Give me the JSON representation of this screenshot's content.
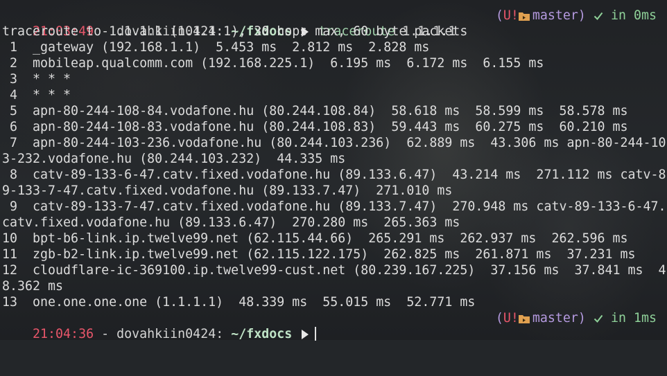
{
  "prompt1": {
    "time": "21:03:49",
    "sep": " - ",
    "user": "dovahkiin0424:",
    "path": "~/fxdocs",
    "command": "traceroute",
    "argument": "1.1.1.1",
    "git_open": "(",
    "git_status": "U!",
    "branch": "master",
    "git_close": ")",
    "duration": "in 0ms"
  },
  "output_lines": [
    "traceroute to 1.1.1.1 (1.1.1.1), 30 hops max, 60 byte packets",
    " 1  _gateway (192.168.1.1)  5.453 ms  2.812 ms  2.828 ms",
    " 2  mobileap.qualcomm.com (192.168.225.1)  6.195 ms  6.172 ms  6.155 ms",
    " 3  * * *",
    " 4  * * *",
    " 5  apn-80-244-108-84.vodafone.hu (80.244.108.84)  58.618 ms  58.599 ms  58.578 ms",
    " 6  apn-80-244-108-83.vodafone.hu (80.244.108.83)  59.443 ms  60.275 ms  60.210 ms",
    " 7  apn-80-244-103-236.vodafone.hu (80.244.103.236)  62.889 ms  43.306 ms apn-80-244-10",
    "3-232.vodafone.hu (80.244.103.232)  44.335 ms",
    " 8  catv-89-133-6-47.catv.fixed.vodafone.hu (89.133.6.47)  43.214 ms  271.112 ms catv-8",
    "9-133-7-47.catv.fixed.vodafone.hu (89.133.7.47)  271.010 ms",
    " 9  catv-89-133-7-47.catv.fixed.vodafone.hu (89.133.7.47)  270.948 ms catv-89-133-6-47.",
    "catv.fixed.vodafone.hu (89.133.6.47)  270.280 ms  265.363 ms",
    "10  bpt-b6-link.ip.twelve99.net (62.115.44.66)  265.291 ms  262.937 ms  262.596 ms",
    "11  zgb-b2-link.ip.twelve99.net (62.115.122.175)  262.825 ms  261.871 ms  37.231 ms",
    "12  cloudflare-ic-369100.ip.twelve99-cust.net (80.239.167.225)  37.156 ms  37.841 ms  4",
    "8.362 ms",
    "13  one.one.one.one (1.1.1.1)  48.339 ms  55.015 ms  52.771 ms"
  ],
  "prompt2": {
    "time": "21:04:36",
    "sep": " - ",
    "user": "dovahkiin0424:",
    "path": "~/fxdocs",
    "git_open": "(",
    "git_status": "U!",
    "branch": "master",
    "git_close": ")",
    "duration": "in 1ms"
  },
  "colors": {
    "background": "#232629",
    "time": "#e8566a",
    "path": "#bfe3c6",
    "command": "#9fcfa9",
    "branch": "#b59ae0",
    "success": "#8fd199"
  },
  "icons": [
    "prompt-arrow-icon",
    "git-folder-icon",
    "check-icon"
  ]
}
